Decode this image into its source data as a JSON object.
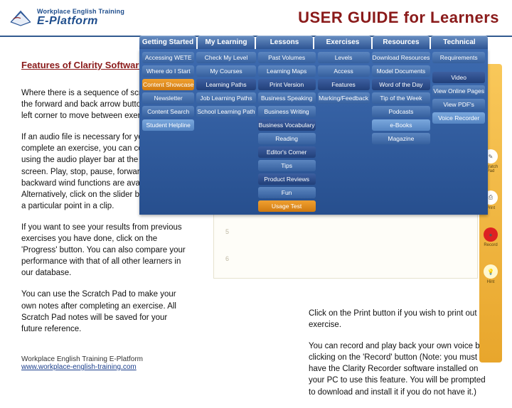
{
  "header": {
    "brand_line1": "Workplace English Training",
    "brand_line2": "E-Platform",
    "page_title": "USER GUIDE for Learners"
  },
  "section_heading": "Features of Clarity Software",
  "left_paragraphs": [
    "Where there is a sequence of screens, use the forward and back arrow buttons in the top left corner to move between exercises.",
    "If an audio file is necessary for you to complete an exercise, you can control the file using the audio player bar at the top of the screen. Play, stop, pause, forward wind and backward wind functions are available. Alternatively, click on the slider bar to move to a particular point in a clip.",
    "If you want to see your results from previous exercises you have done, click on the 'Progress' button. You can also compare your performance with that of all other learners in our database.",
    "You can use the Scratch Pad to make your own notes after completing an exercise. All Scratch Pad notes will be saved for your future reference."
  ],
  "right_paragraphs": [
    "Click on the Print button if you wish to print out an exercise.",
    "You can record and play back your own voice by clicking on the 'Record' button (Note: you must have the Clarity Recorder software installed on your PC to use this feature. You will be prompted to download and install it if you do not have it.)"
  ],
  "footer": {
    "line1": "Workplace English Training E-Platform",
    "link": "www.workplace-english-training.com"
  },
  "menu": {
    "tabs": [
      "Getting Started",
      "My Learning",
      "Lessons",
      "Exercises",
      "Resources",
      "Technical"
    ],
    "columns": [
      [
        {
          "t": "Accessing WETE",
          "c": "blue"
        },
        {
          "t": "Where do I Start",
          "c": "blue"
        },
        {
          "t": "Content Showcase",
          "c": "orange"
        },
        {
          "t": "Newsletter",
          "c": "blue"
        },
        {
          "t": "Content Search",
          "c": "blue"
        },
        {
          "t": "Student Helpline",
          "c": "lightblue"
        }
      ],
      [
        {
          "t": "Check My Level",
          "c": "blue"
        },
        {
          "t": "My Courses",
          "c": "blue"
        },
        {
          "t": "Learning Paths",
          "c": "darkblue"
        },
        {
          "t": "Job Learning Paths",
          "c": "blue"
        },
        {
          "t": "School Learning Path",
          "c": "blue"
        }
      ],
      [
        {
          "t": "Past Volumes",
          "c": "blue"
        },
        {
          "t": "Learning Maps",
          "c": "blue"
        },
        {
          "t": "Print Version",
          "c": "darkblue"
        },
        {
          "t": "Business Speaking",
          "c": "blue"
        },
        {
          "t": "Business Writing",
          "c": "blue"
        },
        {
          "t": "Business Vocabulary",
          "c": "darkblue"
        },
        {
          "t": "Reading",
          "c": "blue"
        },
        {
          "t": "Editor's Corner",
          "c": "darkblue"
        },
        {
          "t": "Tips",
          "c": "blue"
        },
        {
          "t": "Product Reviews",
          "c": "darkblue"
        },
        {
          "t": "Fun",
          "c": "blue"
        },
        {
          "t": "Usage Test",
          "c": "orange"
        }
      ],
      [
        {
          "t": "Levels",
          "c": "blue"
        },
        {
          "t": "Access",
          "c": "blue"
        },
        {
          "t": "Features",
          "c": "darkblue"
        },
        {
          "t": "Marking/Feedback",
          "c": "blue"
        }
      ],
      [
        {
          "t": "Download Resources",
          "c": "blue"
        },
        {
          "t": "Model Documents",
          "c": "blue"
        },
        {
          "t": "Word of the Day",
          "c": "darkblue"
        },
        {
          "t": "Tip of the Week",
          "c": "blue"
        },
        {
          "t": "Podcasts",
          "c": "blue"
        },
        {
          "t": "e-Books",
          "c": "lightblue"
        },
        {
          "t": "Magazine",
          "c": "blue"
        }
      ],
      [
        {
          "t": "Requirements",
          "c": "blue"
        },
        {
          "t": "",
          "c": "blue"
        },
        {
          "t": "Video",
          "c": "darkblue"
        },
        {
          "t": "View Online Pages",
          "c": "blue"
        },
        {
          "t": "View PDF's",
          "c": "blue"
        },
        {
          "t": "Voice Recorder",
          "c": "lightblue"
        }
      ]
    ]
  },
  "side_tools": [
    {
      "icon": "✎",
      "label": "Scratch Pad"
    },
    {
      "icon": "⎙",
      "label": "Print"
    },
    {
      "icon": "●",
      "label": "Record"
    },
    {
      "icon": "💡",
      "label": "Hint"
    }
  ]
}
